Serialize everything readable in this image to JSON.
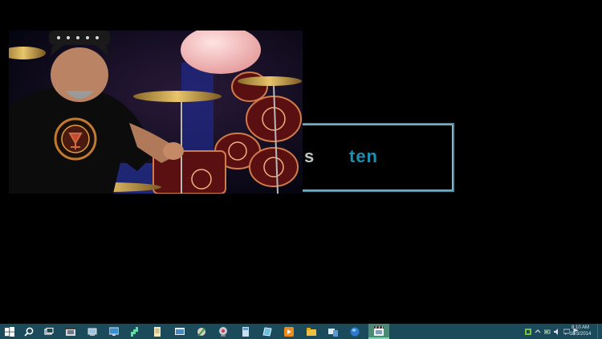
{
  "colors": {
    "desktop": "#000000",
    "taskbar": "#1b4a5a",
    "taskbar_active": "#4b8a76",
    "logo_border": "#4a8fa6",
    "logo_accent": "#1e8fb0"
  },
  "logo_window": {
    "text_left": "s",
    "text_right": "ten"
  },
  "video_window": {
    "content": "drummer-performance-frame"
  },
  "taskbar": {
    "buttons": [
      {
        "icon": "windows-start-icon"
      },
      {
        "icon": "search-icon"
      },
      {
        "icon": "task-view-icon"
      },
      {
        "icon": "film-icon"
      },
      {
        "icon": "computer-icon"
      },
      {
        "icon": "monitor-icon"
      },
      {
        "icon": "grid-app-icon"
      },
      {
        "icon": "document-icon"
      },
      {
        "icon": "window-app-icon"
      },
      {
        "icon": "paint-icon"
      },
      {
        "icon": "media-center-icon"
      },
      {
        "icon": "calculator-icon"
      },
      {
        "icon": "image-app-icon"
      },
      {
        "icon": "media-player-icon"
      },
      {
        "icon": "file-explorer-icon"
      },
      {
        "icon": "devices-icon"
      },
      {
        "icon": "globe-icon"
      },
      {
        "icon": "video-editor-icon",
        "active": true
      }
    ],
    "tray_icons": [
      "network-app-icon",
      "chevron-icon",
      "battery-icon",
      "volume-icon",
      "message-icon",
      "flag-icon"
    ],
    "clock": {
      "time": "8:10 AM",
      "date": "10/3/2014"
    }
  }
}
